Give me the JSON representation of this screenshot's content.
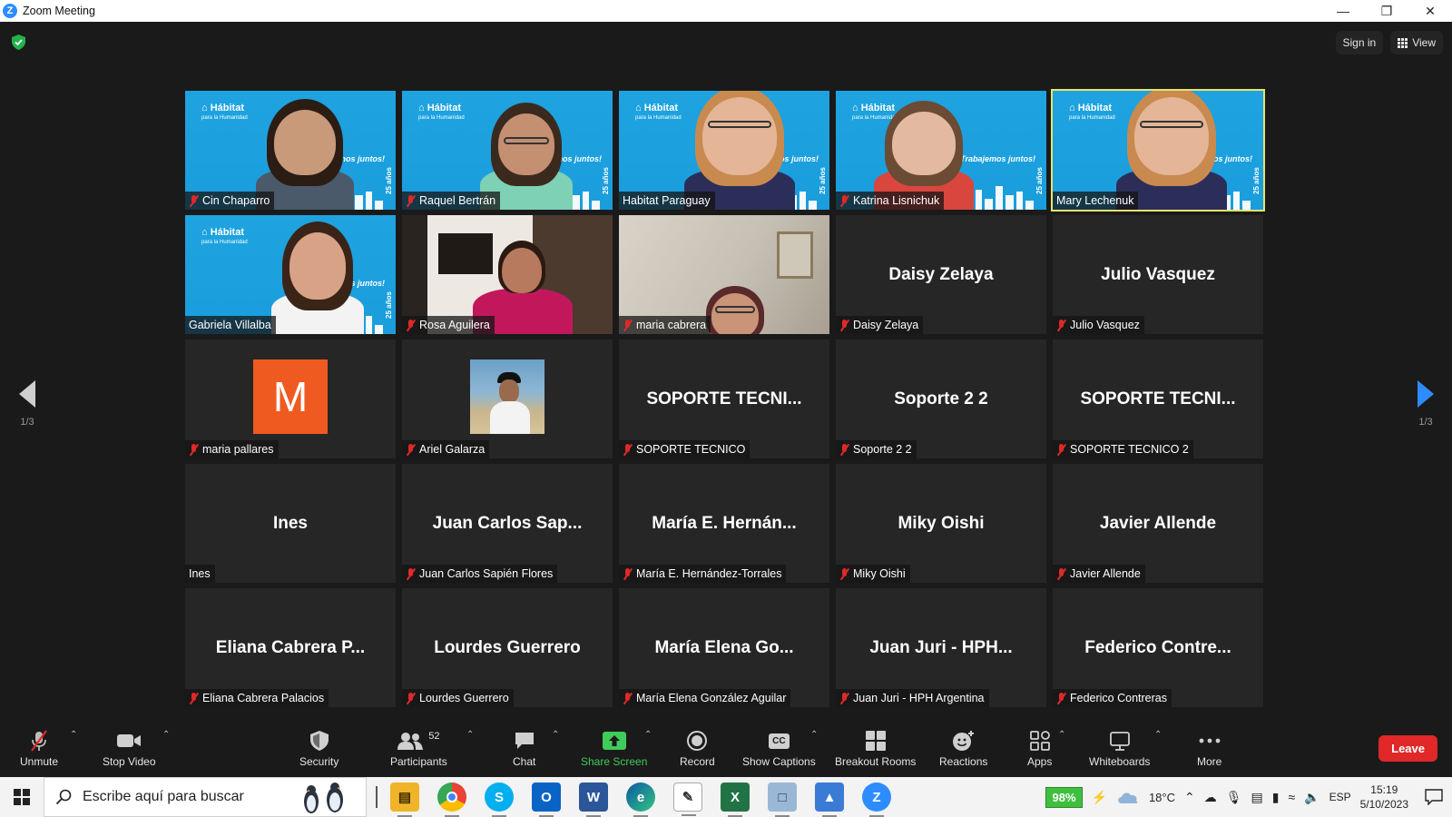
{
  "window": {
    "title": "Zoom Meeting",
    "icon": "zoom-logo"
  },
  "top_controls": {
    "sign_in": "Sign in",
    "view": "View"
  },
  "pagination": {
    "left": "1/3",
    "right": "1/3"
  },
  "tiles": [
    {
      "name": "Cin Chaparro",
      "muted": true,
      "kind": "video"
    },
    {
      "name": "Raquel Bertrán",
      "muted": true,
      "kind": "video"
    },
    {
      "name": "Habitat Paraguay",
      "muted": false,
      "kind": "video"
    },
    {
      "name": "Katrina Lisnichuk",
      "muted": true,
      "kind": "video"
    },
    {
      "name": "Mary Lechenuk",
      "muted": false,
      "kind": "video",
      "active_speaker": true
    },
    {
      "name": "Gabriela Villalba",
      "muted": false,
      "kind": "video"
    },
    {
      "name": "Rosa Aguilera",
      "muted": true,
      "kind": "video"
    },
    {
      "name": "maria cabrera",
      "muted": true,
      "kind": "video"
    },
    {
      "name": "Daisy Zelaya",
      "display": "Daisy Zelaya",
      "muted": true,
      "kind": "name"
    },
    {
      "name": "Julio Vasquez",
      "display": "Julio Vasquez",
      "muted": true,
      "kind": "name"
    },
    {
      "name": "maria pallares",
      "muted": true,
      "kind": "avatar",
      "initial": "M",
      "avatar_color": "#ef5a21"
    },
    {
      "name": "Ariel Galarza",
      "muted": true,
      "kind": "photo"
    },
    {
      "name": "SOPORTE TECNICO",
      "display": "SOPORTE TECNI...",
      "muted": true,
      "kind": "name"
    },
    {
      "name": "Soporte 2 2",
      "display": "Soporte 2 2",
      "muted": true,
      "kind": "name"
    },
    {
      "name": "SOPORTE TECNICO 2",
      "display": "SOPORTE TECNI...",
      "muted": true,
      "kind": "name"
    },
    {
      "name": "Ines",
      "display": "Ines",
      "muted": false,
      "kind": "name"
    },
    {
      "name": "Juan Carlos Sapién Flores",
      "display": "Juan Carlos Sap...",
      "muted": true,
      "kind": "name"
    },
    {
      "name": "María E. Hernández-Torrales",
      "display": "María E. Hernán...",
      "muted": true,
      "kind": "name"
    },
    {
      "name": "Miky Oishi",
      "display": "Miky Oishi",
      "muted": true,
      "kind": "name"
    },
    {
      "name": "Javier Allende",
      "display": "Javier Allende",
      "muted": true,
      "kind": "name"
    },
    {
      "name": "Eliana Cabrera Palacios",
      "display": "Eliana Cabrera P...",
      "muted": true,
      "kind": "name"
    },
    {
      "name": "Lourdes Guerrero",
      "display": "Lourdes Guerrero",
      "muted": true,
      "kind": "name"
    },
    {
      "name": "María Elena González Aguilar",
      "display": "María Elena Go...",
      "muted": true,
      "kind": "name"
    },
    {
      "name": "Juan Juri - HPH Argentina",
      "display": "Juan Juri - HPH...",
      "muted": true,
      "kind": "name"
    },
    {
      "name": "Federico Contreras",
      "display": "Federico Contre...",
      "muted": true,
      "kind": "name"
    }
  ],
  "habitat_bg": {
    "logo": "Hábitat",
    "logo_sub": "para la Humanidad",
    "slogan": "¡Trabajemos juntos!",
    "years": "25 años"
  },
  "toolbar": {
    "unmute": "Unmute",
    "stop_video": "Stop Video",
    "security": "Security",
    "participants": "Participants",
    "participants_count": "52",
    "chat": "Chat",
    "share_screen": "Share Screen",
    "record": "Record",
    "show_captions": "Show Captions",
    "captions_badge": "CC",
    "breakout_rooms": "Breakout Rooms",
    "reactions": "Reactions",
    "apps": "Apps",
    "whiteboards": "Whiteboards",
    "more": "More",
    "leave": "Leave"
  },
  "colors": {
    "accent": "#2d8cff",
    "share_green": "#3fcc5a",
    "leave_red": "#e02828",
    "mute_red": "#e02828",
    "speaker_outline": "#e7e36a"
  },
  "taskbar": {
    "search_placeholder": "Escribe aquí para buscar",
    "apps": [
      "file-explorer",
      "chrome",
      "skype",
      "outlook",
      "word",
      "edge",
      "paint",
      "excel",
      "notes",
      "photos",
      "zoom"
    ],
    "battery": "98%",
    "weather": "18°C",
    "language": "ESP",
    "time": "15:19",
    "date": "5/10/2023"
  }
}
